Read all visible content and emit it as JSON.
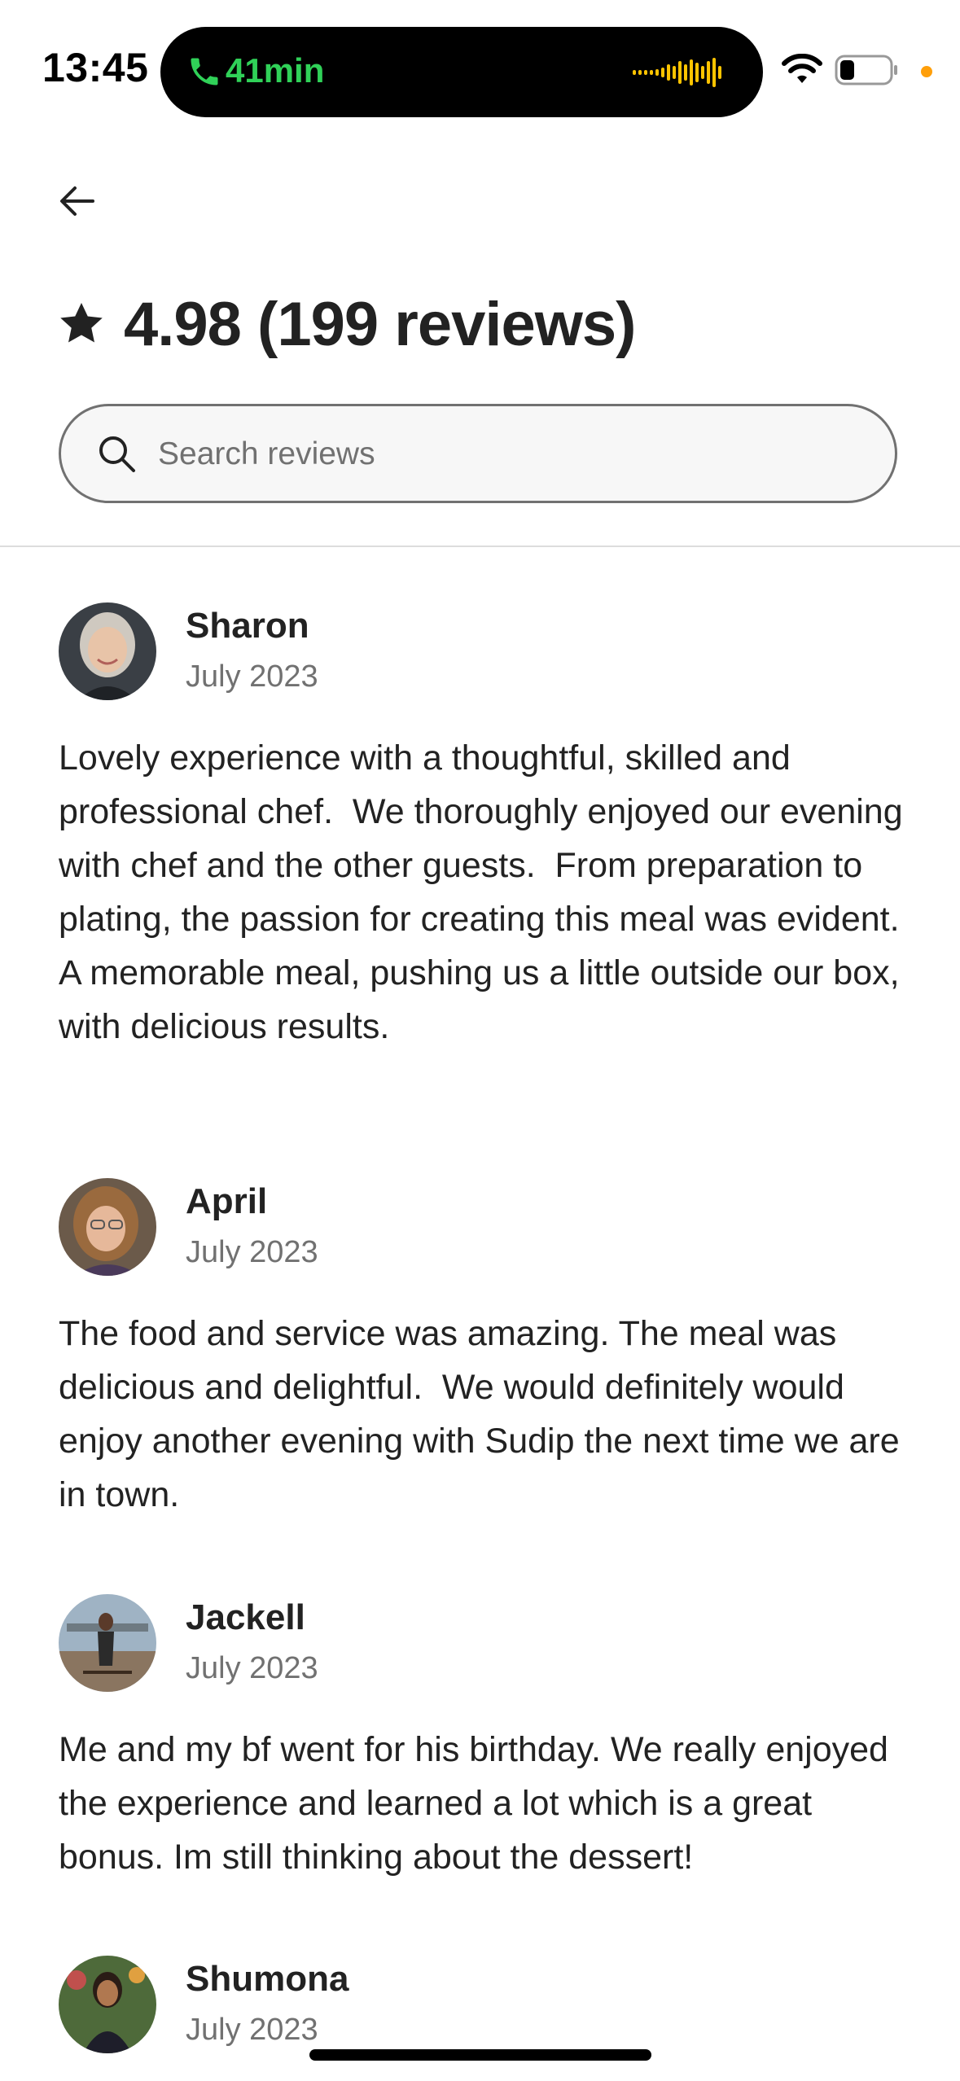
{
  "status_bar": {
    "time": "13:45",
    "call_duration": "41min",
    "colors": {
      "call_green": "#30d158",
      "wave_amber": "#ffc400",
      "dot_orange": "#ff9f0a"
    }
  },
  "header": {
    "back_icon": "arrow-left-icon",
    "rating_icon": "star-icon",
    "rating_text": "4.98 (199 reviews)"
  },
  "search": {
    "icon": "search-icon",
    "placeholder": "Search reviews"
  },
  "reviews": [
    {
      "name": "Sharon",
      "date": "July 2023",
      "text": "Lovely experience with a thoughtful, skilled and professional chef.  We thoroughly enjoyed our evening with chef and the other guests.  From preparation to plating, the passion for creating this meal was evident.  A memorable meal, pushing us a little outside our box, with delicious results."
    },
    {
      "name": "April",
      "date": "July 2023",
      "text": "The food and service was amazing. The meal was delicious and delightful.  We would definitely would enjoy another evening with Sudip the next time we are in town."
    },
    {
      "name": "Jackell",
      "date": "July 2023",
      "text": "Me and my bf went for his birthday. We really enjoyed the experience and learned a lot which is a great bonus. Im still thinking about the dessert!"
    },
    {
      "name": "Shumona",
      "date": "July 2023",
      "text": ""
    }
  ]
}
